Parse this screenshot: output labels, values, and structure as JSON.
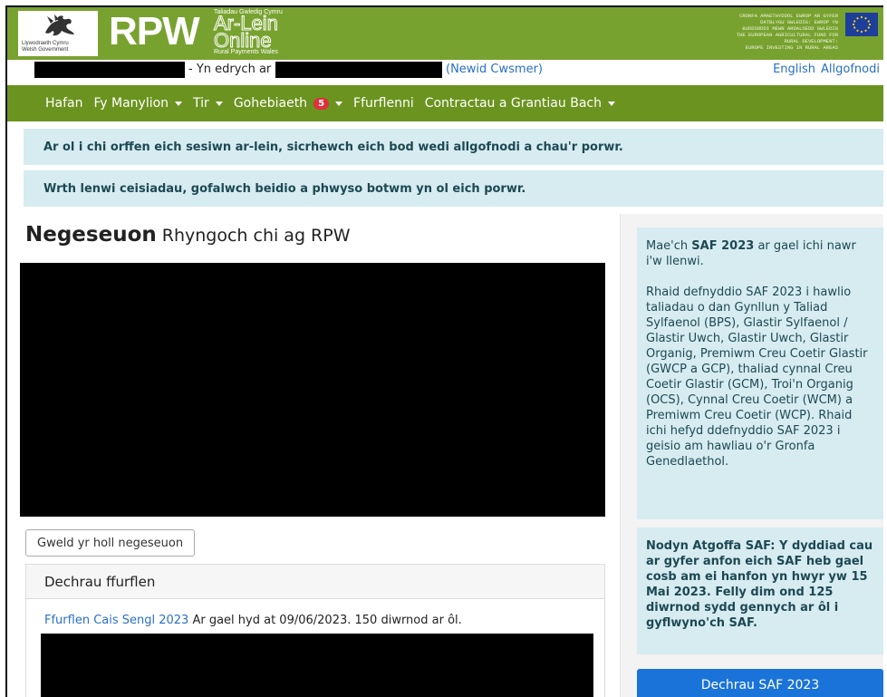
{
  "header": {
    "gov_name_line1": "Llywodraeth Cymru",
    "gov_name_line2": "Welsh Government",
    "logo_text": "RPW",
    "arlein_top": "Taliadau Gwledig Cymru",
    "arlein_line1": "Ar-Lein",
    "arlein_line2": "Online",
    "arlein_bottom": "Rural Payments Wales",
    "eu_line1": "CRONFA AMAETHYDDOL EWROP AR GYFER",
    "eu_line2": "DATBLYGU GWLEDIG: EWROP YN",
    "eu_line3": "BUDDSODDI MEWN ARDALOEDD GWLEDIG",
    "eu_line4": "THE EUROPEAN AGRICULTURAL FUND FOR",
    "eu_line5": "RURAL DEVELOPMENT:",
    "eu_line6": "EUROPE INVESTING IN RURAL AREAS",
    "eu_flag_icon": "eu-flag-icon"
  },
  "customer_bar": {
    "viewing_label": "- Yn edrych ar",
    "change_customer": "(Newid Cwsmer)",
    "english": "English",
    "logout": "Allgofnodi"
  },
  "nav": {
    "items": [
      {
        "label": "Hafan"
      },
      {
        "label": "Fy Manylion"
      },
      {
        "label": "Tir"
      },
      {
        "label": "Gohebiaeth",
        "badge": "5"
      },
      {
        "label": "Ffurflenni"
      },
      {
        "label": "Contractau a Grantiau Bach"
      }
    ]
  },
  "alerts": {
    "logout_warning": "Ar ol i chi orffen eich sesiwn ar-lein, sicrhewch eich bod wedi allgofnodi a chau'r porwr.",
    "back_warning": "Wrth lenwi ceisiadau, gofalwch beidio a phwyso botwm yn ol eich porwr."
  },
  "main": {
    "title": "Negeseuon",
    "subtitle": "Rhyngoch chi ag RPW",
    "view_all_button": "Gweld yr holl negeseuon",
    "card_title": "Dechrau ffurflen",
    "form_link": "Ffurflen Cais Sengl 2023",
    "form_text": "Ar gael hyd at 09/06/2023. 150 diwrnod ar ôl."
  },
  "sidebar": {
    "info_p1_pre": "Mae'ch",
    "info_p1_bold": "SAF 2023",
    "info_p1_post": "ar gael ichi nawr i'w llenwi.",
    "info_p2": "Rhaid defnyddio SAF 2023 i hawlio taliadau o dan Gynllun y Taliad Sylfaenol (BPS), Glastir Sylfaenol / Glastir Uwch, Glastir Uwch, Glastir Organig, Premiwm Creu Coetir Glastir (GWCP a GCP), thaliad cynnal Creu Coetir Glastir (GCM), Troi'n Organig (OCS), Cynnal Creu Coetir (WCM) a Premiwm Creu Coetir (WCP). Rhaid ichi hefyd ddefnyddio SAF 2023 i geisio am hawliau o'r Gronfa Genedlaethol.",
    "reminder": "Nodyn Atgoffa SAF: Y dyddiad cau ar gyfer anfon eich SAF heb gael cosb am ei hanfon yn hwyr yw 15 Mai 2023. Felly dim ond 125 diwrnod sydd gennych ar ôl i gyflwyno'ch SAF.",
    "start_button": "Dechrau SAF 2023"
  },
  "colors": {
    "header_green": "#78a22f",
    "nav_green": "#6b931f",
    "alert_bg": "#d6ecf0",
    "link_blue": "#2a6fc9",
    "primary_button": "#1a73d9",
    "badge_red": "#e02f3c"
  }
}
